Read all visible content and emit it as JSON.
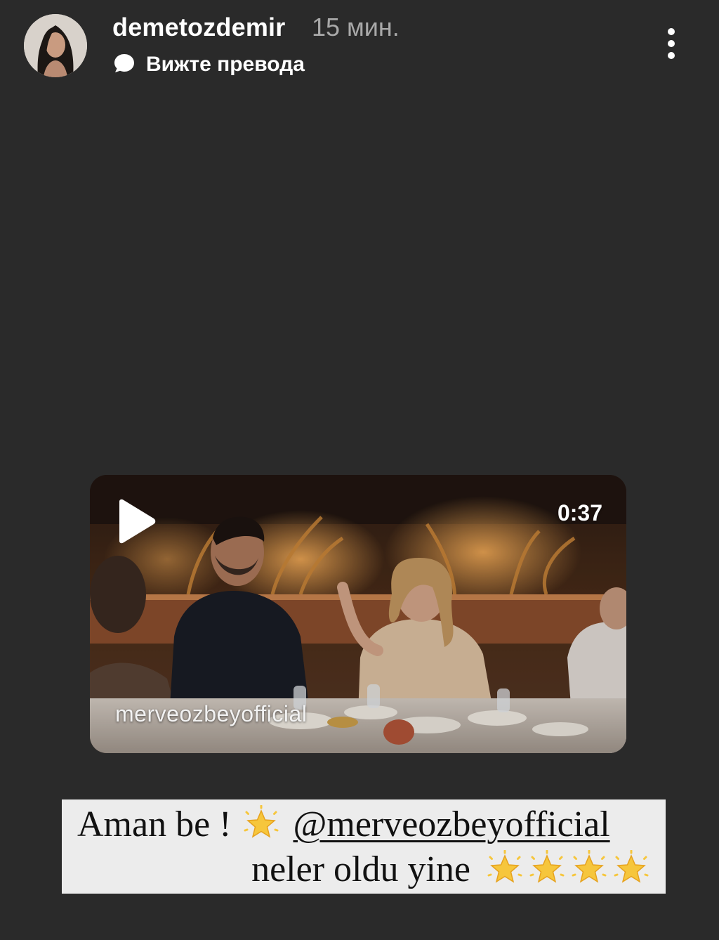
{
  "header": {
    "username": "demetozdemir",
    "time_ago": "15 мин.",
    "translate_label": "Вижте превода"
  },
  "video": {
    "duration": "0:37",
    "watermark": "merveozbeyofficial"
  },
  "caption": {
    "line1_text": "Aman be !",
    "mention": "@merveozbeyofficial",
    "line2_text": "neler oldu yine"
  },
  "icons": {
    "avatar": "profile-photo",
    "translate": "speech-bubble-icon",
    "more": "more-vertical-icon",
    "play": "play-icon",
    "star": "glowing-star-emoji"
  },
  "colors": {
    "background": "#2a2a2a",
    "caption_background": "#ececec",
    "star": "#f6c63c"
  }
}
